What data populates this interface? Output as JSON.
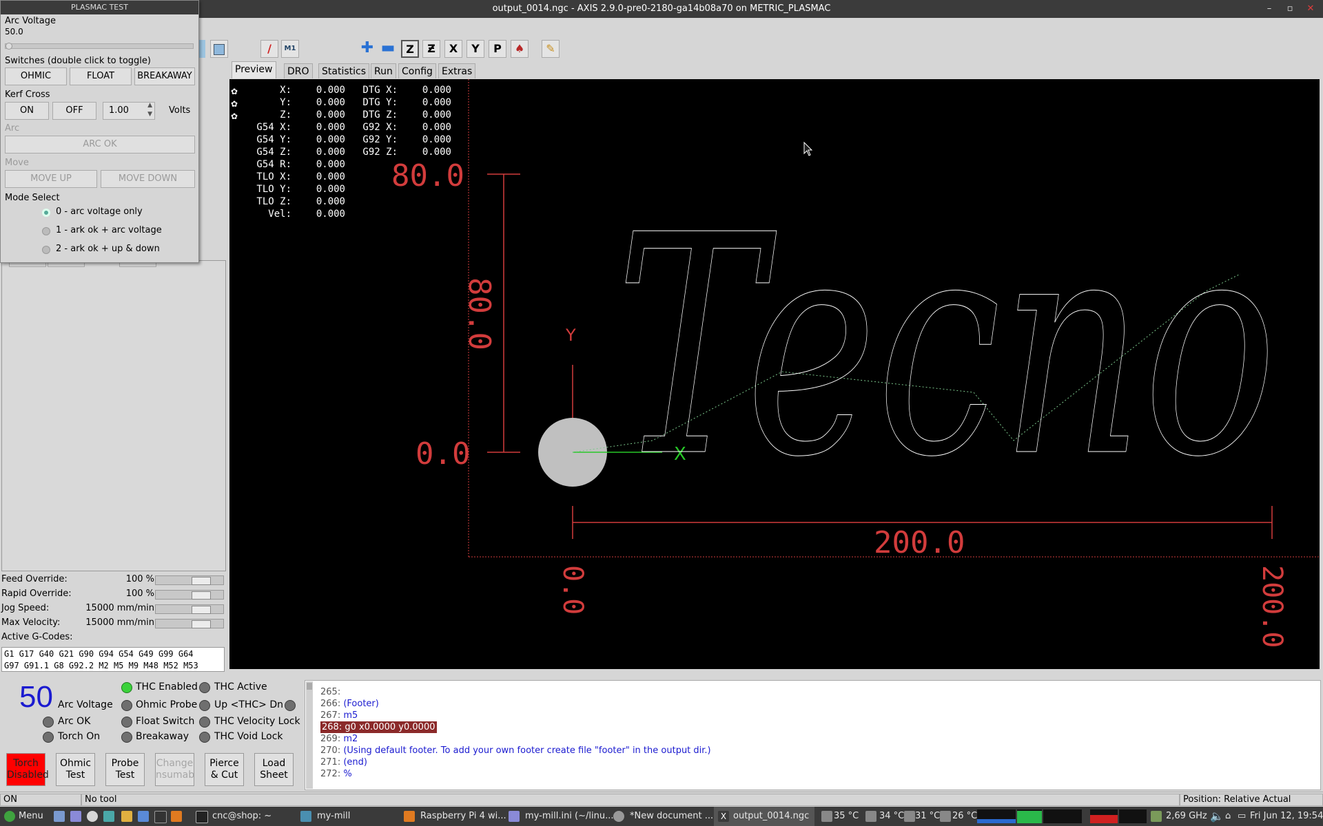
{
  "window": {
    "title": "output_0014.ngc - AXIS 2.9.0-pre0-2180-ga14b08a70 on METRIC_PLASMAC",
    "minimize": "–",
    "maximize": "▫",
    "close": "✕"
  },
  "plasmac_test": {
    "title": "PLASMAC TEST",
    "arc_voltage_label": "Arc Voltage",
    "arc_voltage_value": "50.0",
    "switches_label": "Switches (double click to toggle)",
    "switch_ohmic": "OHMIC",
    "switch_float": "FLOAT",
    "switch_breakaway": "BREAKAWAY",
    "kerf_label": "Kerf Cross",
    "kerf_on": "ON",
    "kerf_off": "OFF",
    "kerf_value": "1.00",
    "kerf_unit": "Volts",
    "arc_label": "Arc",
    "arc_ok": "ARC OK",
    "move_label": "Move",
    "move_up": "MOVE UP",
    "move_down": "MOVE DOWN",
    "mode_label": "Mode Select",
    "modes": [
      "0 - arc voltage only",
      "1 - ark ok + arc voltage",
      "2 - ark ok + up & down"
    ],
    "selected_mode": 0
  },
  "tabs": [
    "Preview",
    "DRO",
    "Statistics",
    "Run",
    "Config",
    "Extras"
  ],
  "active_tab": "Preview",
  "overrides": {
    "feed_label": "Feed Override:",
    "feed_value": "100 %",
    "feed_level": 1.0,
    "rapid_label": "Rapid Override:",
    "rapid_value": "100 %",
    "rapid_level": 1.0,
    "jog_label": "Jog Speed:",
    "jog_value": "15000 mm/min",
    "jog_level": 1.0,
    "maxvel_label": "Max Velocity:",
    "maxvel_value": "15000 mm/min",
    "maxvel_level": 1.0,
    "active_gcodes_label": "Active G-Codes:",
    "active_gcodes": "G1 G17 G40 G21 G90 G94 G54 G49 G99 G64\nG97 G91.1 G8 G92.2 M2 M5 M9 M48 M52 M53"
  },
  "dro": {
    "rows": [
      {
        "label": "X:",
        "value": "0.000",
        "dtg_label": "DTG X:",
        "dtg_value": "0.000"
      },
      {
        "label": "Y:",
        "value": "0.000",
        "dtg_label": "DTG Y:",
        "dtg_value": "0.000"
      },
      {
        "label": "Z:",
        "value": "0.000",
        "dtg_label": "DTG Z:",
        "dtg_value": "0.000"
      },
      {
        "label": "G54 X:",
        "value": "0.000",
        "dtg_label": "G92 X:",
        "dtg_value": "0.000"
      },
      {
        "label": "G54 Y:",
        "value": "0.000",
        "dtg_label": "G92 Y:",
        "dtg_value": "0.000"
      },
      {
        "label": "G54 Z:",
        "value": "0.000",
        "dtg_label": "G92 Z:",
        "dtg_value": "0.000"
      },
      {
        "label": "G54 R:",
        "value": "0.000",
        "dtg_label": "",
        "dtg_value": ""
      },
      {
        "label": "TLO X:",
        "value": "0.000",
        "dtg_label": "",
        "dtg_value": ""
      },
      {
        "label": "TLO Y:",
        "value": "0.000",
        "dtg_label": "",
        "dtg_value": ""
      },
      {
        "label": "TLO Z:",
        "value": "0.000",
        "dtg_label": "",
        "dtg_value": ""
      },
      {
        "label": "Vel:",
        "value": "0.000",
        "dtg_label": "",
        "dtg_value": ""
      }
    ]
  },
  "preview": {
    "text": "Tecno",
    "dim_y_top": "80.0",
    "dim_y_bottom": "0.0",
    "dim_y_len": "80.0",
    "dim_x_len": "200.0",
    "dim_x_left": "0.0",
    "dim_x_right": "200.0",
    "axis_x": "X",
    "axis_y": "Y",
    "colors": {
      "dimension": "#d23c3c",
      "outline": "#ffffff",
      "rapid": "#7cc88c",
      "axis_x": "#28c828",
      "tool": "#c0c0c0"
    }
  },
  "plasma_status": {
    "arc_voltage": "50",
    "arc_voltage_label": "Arc Voltage",
    "leds": [
      {
        "label": "THC Enabled",
        "on": true
      },
      {
        "label": "THC Active",
        "on": false
      },
      {
        "label": "Ohmic Probe",
        "on": false
      },
      {
        "label": "Up <THC> Dn",
        "on": false
      },
      {
        "label": "Arc OK",
        "on": false
      },
      {
        "label": "Float Switch",
        "on": false
      },
      {
        "label": "THC Velocity Lock",
        "on": false
      },
      {
        "label": "Torch On",
        "on": false
      },
      {
        "label": "Breakaway",
        "on": false
      },
      {
        "label": "THC Void Lock",
        "on": false
      }
    ],
    "buttons": [
      {
        "label": "Torch Disabled",
        "l1": "Torch",
        "l2": "Disabled"
      },
      {
        "label": "Ohmic Test",
        "l1": "Ohmic",
        "l2": "Test"
      },
      {
        "label": "Probe Test",
        "l1": "Probe",
        "l2": "Test"
      },
      {
        "label": "Change Consumable",
        "l1": "Change",
        "l2": "nsumabl"
      },
      {
        "label": "Pierce & Cut",
        "l1": "Pierce",
        "l2": "& Cut"
      },
      {
        "label": "Load Sheet",
        "l1": "Load",
        "l2": "Sheet"
      }
    ]
  },
  "gcode": {
    "lines": [
      {
        "num": "265:",
        "text": ""
      },
      {
        "num": "266:",
        "text": "(Footer)"
      },
      {
        "num": "267:",
        "text": "m5"
      },
      {
        "num": "268:",
        "text": "g0 x0.0000 y0.0000"
      },
      {
        "num": "269:",
        "text": "m2"
      },
      {
        "num": "270:",
        "text": "(Using default footer. To add your own footer create file \"footer\" in the output dir.)"
      },
      {
        "num": "271:",
        "text": "(end)"
      },
      {
        "num": "272:",
        "text": "%"
      }
    ],
    "highlighted": "268:"
  },
  "status_bar": {
    "state": "ON",
    "tool": "No tool",
    "position": "Position: Relative Actual"
  },
  "taskbar": {
    "menu": "Menu",
    "items": [
      "cnc@shop: ~",
      "my-mill",
      "Raspberry Pi 4 wi...",
      "my-mill.ini (~/linu...",
      "*New document ...",
      "output_0014.ngc"
    ],
    "temps": [
      "35 °C",
      "34 °C",
      "31 °C",
      "26 °C"
    ],
    "cpu_freq": "2,69 GHz",
    "clock": "Fri Jun 12, 19:54"
  }
}
